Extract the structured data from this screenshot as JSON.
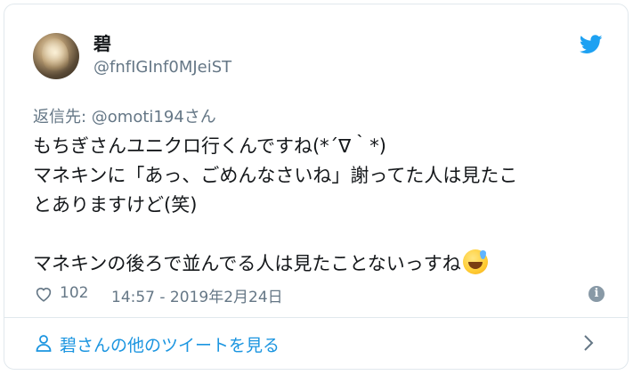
{
  "user": {
    "display_name": "碧",
    "screen_name": "@fnfIGInf0MJeiST",
    "avatar_icon": "user-avatar",
    "platform_icon": "twitter-bird-icon"
  },
  "reply": {
    "prefix": "返信先: ",
    "mention": "@omoti194さん"
  },
  "tweet": {
    "lines": [
      "もちぎさんユニクロ行くんですね(*´∇｀*)",
      "マネキンに「あっ、ごめんなさいね」謝ってた人は見たこ",
      "とありますけど(笑)",
      "",
      "マネキンの後ろで並んでる人は見たことないっすね"
    ],
    "emoji": "grinning-sweat-emoji"
  },
  "meta": {
    "likes": "102",
    "timestamp": "14:57 - 2019年2月24日"
  },
  "footer": {
    "label": "碧さんの他のツイートを見る"
  },
  "colors": {
    "accent": "#1b95e0",
    "muted": "#657786",
    "text": "#14171a",
    "border": "#e1e8ed",
    "bird": "#1da1f2"
  }
}
